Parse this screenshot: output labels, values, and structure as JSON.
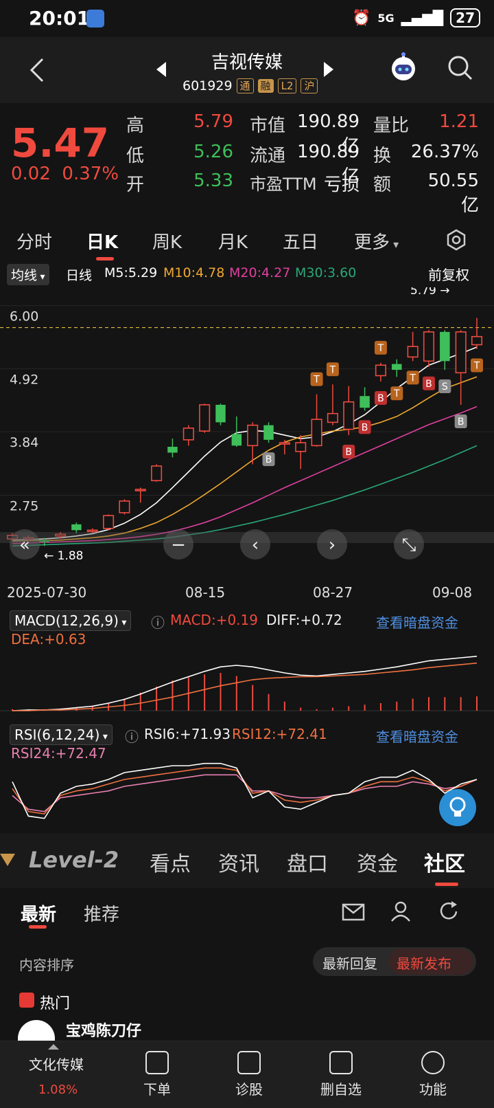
{
  "status": {
    "time": "20:01",
    "network": "5G",
    "battery": "27"
  },
  "header": {
    "title": "吉视传媒",
    "code": "601929",
    "tags": [
      "通",
      "融",
      "L2",
      "沪"
    ]
  },
  "quote": {
    "price": "5.47",
    "change": "0.02",
    "change_pct": "0.37%",
    "high_label": "高",
    "high": "5.79",
    "low_label": "低",
    "low": "5.26",
    "open_label": "开",
    "open": "5.33",
    "mktcap_label": "市值",
    "mktcap": "190.89亿",
    "float_label": "流通",
    "float": "190.89亿",
    "pe_label": "市盈TTM",
    "pe": "亏损",
    "volratio_label": "量比",
    "volratio": "1.21",
    "turnover_label": "换",
    "turnover": "26.37%",
    "amount_label": "额",
    "amount": "50.55亿"
  },
  "tabs": [
    "分时",
    "日K",
    "周K",
    "月K",
    "五日",
    "更多"
  ],
  "ma_legend": {
    "dropdown": "均线",
    "period": "日线",
    "m5": "M5:5.29",
    "m10": "M10:4.78",
    "m20": "M20:4.27",
    "m30": "M30:3.60",
    "adjust": "前复权",
    "colors": {
      "m5": "#ffffff",
      "m10": "#f0a830",
      "m20": "#e040a0",
      "m30": "#2aa878"
    }
  },
  "chart_data": {
    "type": "candlestick",
    "y_ticks": [
      "6.00",
      "4.92",
      "3.84",
      "2.75"
    ],
    "ylim": [
      1.6,
      6.15
    ],
    "high_label": "5.79",
    "low_label": "1.88",
    "dates": [
      "2025-07-30",
      "08-15",
      "08-27",
      "09-08"
    ],
    "candles": [
      {
        "o": 2.0,
        "c": 2.06,
        "h": 2.1,
        "l": 1.96
      },
      {
        "o": 2.0,
        "c": 2.02,
        "h": 2.06,
        "l": 1.96
      },
      {
        "o": 1.98,
        "c": 1.95,
        "h": 2.02,
        "l": 1.88
      },
      {
        "o": 2.05,
        "c": 2.08,
        "h": 2.12,
        "l": 2.0
      },
      {
        "o": 2.25,
        "c": 2.15,
        "h": 2.28,
        "l": 2.1
      },
      {
        "o": 2.15,
        "c": 2.15,
        "h": 2.18,
        "l": 2.1
      },
      {
        "o": 2.18,
        "c": 2.4,
        "h": 2.42,
        "l": 2.15
      },
      {
        "o": 2.45,
        "c": 2.65,
        "h": 2.68,
        "l": 2.42
      },
      {
        "o": 2.85,
        "c": 2.85,
        "h": 2.88,
        "l": 2.62
      },
      {
        "o": 3.0,
        "c": 3.25,
        "h": 3.28,
        "l": 2.98
      },
      {
        "o": 3.58,
        "c": 3.48,
        "h": 3.72,
        "l": 3.4
      },
      {
        "o": 3.7,
        "c": 3.9,
        "h": 3.95,
        "l": 3.6
      },
      {
        "o": 3.85,
        "c": 4.3,
        "h": 4.32,
        "l": 3.82
      },
      {
        "o": 4.3,
        "c": 4.0,
        "h": 4.32,
        "l": 3.95
      },
      {
        "o": 3.8,
        "c": 3.6,
        "h": 4.1,
        "l": 3.58
      },
      {
        "o": 3.6,
        "c": 3.95,
        "h": 4.0,
        "l": 3.28
      },
      {
        "o": 3.95,
        "c": 3.7,
        "h": 4.0,
        "l": 3.65
      },
      {
        "o": 3.65,
        "c": 3.65,
        "h": 3.7,
        "l": 3.45
      },
      {
        "o": 3.5,
        "c": 3.65,
        "h": 3.78,
        "l": 3.2
      },
      {
        "o": 3.6,
        "c": 4.05,
        "h": 4.48,
        "l": 3.58
      },
      {
        "o": 4.0,
        "c": 4.15,
        "h": 4.65,
        "l": 3.95
      },
      {
        "o": 3.88,
        "c": 4.35,
        "h": 4.62,
        "l": 3.78
      },
      {
        "o": 4.45,
        "c": 4.25,
        "h": 4.6,
        "l": 4.2
      },
      {
        "o": 4.8,
        "c": 4.98,
        "h": 5.02,
        "l": 4.7
      },
      {
        "o": 5.0,
        "c": 4.9,
        "h": 5.08,
        "l": 4.78
      },
      {
        "o": 5.12,
        "c": 5.3,
        "h": 5.55,
        "l": 5.05
      },
      {
        "o": 5.05,
        "c": 5.55,
        "h": 5.58,
        "l": 4.95
      },
      {
        "o": 5.55,
        "c": 5.05,
        "h": 5.58,
        "l": 4.9
      },
      {
        "o": 4.85,
        "c": 5.55,
        "h": 5.58,
        "l": 4.3
      },
      {
        "o": 5.33,
        "c": 5.47,
        "h": 5.79,
        "l": 5.26
      }
    ],
    "ma_lines": {
      "m5": [
        1.98,
        1.99,
        2.0,
        2.02,
        2.05,
        2.09,
        2.16,
        2.27,
        2.42,
        2.62,
        2.88,
        3.15,
        3.42,
        3.66,
        3.82,
        3.86,
        3.84,
        3.78,
        3.72,
        3.75,
        3.84,
        3.97,
        4.13,
        4.35,
        4.58,
        4.78,
        4.98,
        5.08,
        5.18,
        5.29
      ],
      "m10": [
        1.96,
        1.97,
        1.97,
        1.98,
        2.0,
        2.02,
        2.05,
        2.1,
        2.18,
        2.28,
        2.42,
        2.58,
        2.76,
        2.95,
        3.15,
        3.35,
        3.52,
        3.66,
        3.75,
        3.8,
        3.85,
        3.88,
        3.92,
        4.0,
        4.1,
        4.25,
        4.42,
        4.58,
        4.68,
        4.78
      ],
      "m20": [
        1.92,
        1.93,
        1.94,
        1.95,
        1.96,
        1.97,
        1.99,
        2.01,
        2.04,
        2.08,
        2.13,
        2.2,
        2.28,
        2.38,
        2.5,
        2.62,
        2.75,
        2.88,
        3.0,
        3.12,
        3.24,
        3.36,
        3.48,
        3.6,
        3.72,
        3.84,
        3.96,
        4.06,
        4.16,
        4.27
      ],
      "m30": [
        1.88,
        1.89,
        1.9,
        1.91,
        1.92,
        1.93,
        1.94,
        1.96,
        1.98,
        2.0,
        2.03,
        2.07,
        2.11,
        2.16,
        2.22,
        2.28,
        2.35,
        2.42,
        2.5,
        2.58,
        2.66,
        2.75,
        2.84,
        2.94,
        3.04,
        3.14,
        3.25,
        3.36,
        3.48,
        3.6
      ]
    },
    "markers": [
      {
        "i": 16,
        "label": "B",
        "pos": "below",
        "color": "#8a8a8a"
      },
      {
        "i": 19,
        "label": "T",
        "pos": "above",
        "color": "#b8641e"
      },
      {
        "i": 20,
        "label": "T",
        "pos": "above",
        "color": "#b8641e"
      },
      {
        "i": 21,
        "label": "B",
        "pos": "below",
        "color": "#c03030"
      },
      {
        "i": 22,
        "label": "B",
        "pos": "below",
        "color": "#c03030"
      },
      {
        "i": 23,
        "label": "B",
        "pos": "below",
        "color": "#c03030"
      },
      {
        "i": 23,
        "label": "T",
        "pos": "above",
        "color": "#b8641e"
      },
      {
        "i": 24,
        "label": "T",
        "pos": "below",
        "color": "#b8641e"
      },
      {
        "i": 25,
        "label": "T",
        "pos": "below",
        "color": "#b8641e"
      },
      {
        "i": 26,
        "label": "B",
        "pos": "below",
        "color": "#c03030"
      },
      {
        "i": 27,
        "label": "S",
        "pos": "below",
        "color": "#8a8a8a"
      },
      {
        "i": 28,
        "label": "B",
        "pos": "below",
        "color": "#8a8a8a"
      },
      {
        "i": 29,
        "label": "T",
        "pos": "below",
        "color": "#b8641e"
      }
    ]
  },
  "macd": {
    "dropdown": "MACD(12,26,9)",
    "macd": "MACD:+0.19",
    "diff": "DIFF:+0.72",
    "dea": "DEA:+0.63",
    "link": "查看暗盘资金",
    "diff_line": [
      0.0,
      0.01,
      0.01,
      0.02,
      0.04,
      0.06,
      0.1,
      0.15,
      0.22,
      0.3,
      0.38,
      0.45,
      0.52,
      0.58,
      0.6,
      0.58,
      0.54,
      0.5,
      0.47,
      0.46,
      0.48,
      0.5,
      0.52,
      0.55,
      0.58,
      0.62,
      0.66,
      0.68,
      0.7,
      0.72
    ],
    "dea_line": [
      0.0,
      0.0,
      0.01,
      0.01,
      0.02,
      0.03,
      0.05,
      0.07,
      0.1,
      0.14,
      0.18,
      0.23,
      0.28,
      0.33,
      0.37,
      0.41,
      0.43,
      0.44,
      0.45,
      0.45,
      0.46,
      0.47,
      0.48,
      0.5,
      0.52,
      0.54,
      0.57,
      0.59,
      0.61,
      0.63
    ],
    "bars": [
      0.02,
      0.02,
      0.02,
      0.03,
      0.04,
      0.06,
      0.1,
      0.16,
      0.24,
      0.32,
      0.4,
      0.44,
      0.48,
      0.5,
      0.46,
      0.34,
      0.22,
      0.12,
      0.04,
      0.02,
      0.04,
      0.06,
      0.08,
      0.1,
      0.12,
      0.16,
      0.18,
      0.18,
      0.18,
      0.19
    ]
  },
  "rsi": {
    "dropdown": "RSI(6,12,24)",
    "rsi6": "RSI6:+71.93",
    "rsi12": "RSI12:+72.41",
    "rsi24": "RSI24:+72.47",
    "link": "查看暗盘资金",
    "r6": [
      70,
      40,
      38,
      60,
      66,
      68,
      72,
      78,
      80,
      82,
      84,
      84,
      86,
      86,
      82,
      56,
      62,
      48,
      46,
      52,
      58,
      60,
      70,
      74,
      74,
      80,
      72,
      60,
      68,
      72
    ],
    "r12": [
      64,
      44,
      42,
      58,
      62,
      64,
      68,
      72,
      74,
      76,
      78,
      80,
      82,
      82,
      80,
      60,
      62,
      54,
      52,
      54,
      58,
      60,
      66,
      70,
      70,
      74,
      70,
      62,
      66,
      72
    ],
    "r24": [
      58,
      46,
      44,
      56,
      58,
      60,
      62,
      66,
      68,
      70,
      72,
      74,
      76,
      76,
      76,
      62,
      62,
      58,
      56,
      56,
      58,
      60,
      64,
      66,
      66,
      70,
      68,
      64,
      66,
      72
    ]
  },
  "lower_tabs": {
    "level2": "Level-2",
    "items": [
      "看点",
      "资讯",
      "盘口",
      "资金",
      "社区"
    ]
  },
  "sub_tabs": [
    "最新",
    "推荐"
  ],
  "sorting": {
    "label": "内容排序",
    "opt1": "最新回复",
    "opt2": "最新发布"
  },
  "hot": {
    "label": "热门",
    "user": "宝鸡陈刀仔"
  },
  "bottom_nav": {
    "sector": "文化传媒",
    "sector_pct": "1.08%",
    "items": [
      "下单",
      "诊股",
      "删自选",
      "功能"
    ]
  }
}
